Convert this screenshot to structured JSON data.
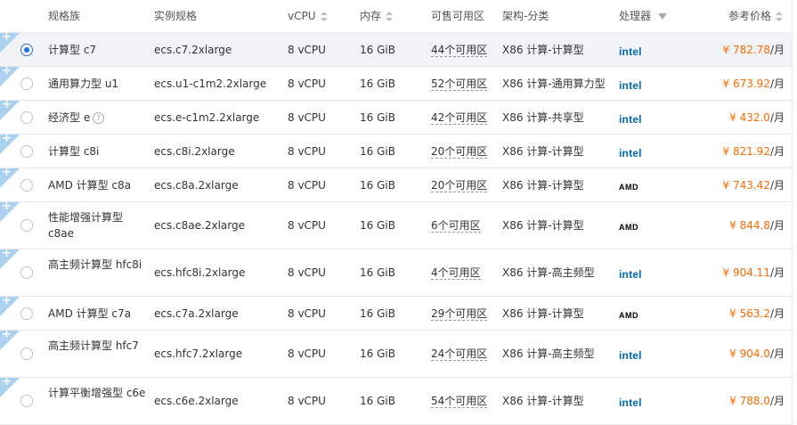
{
  "header": {
    "family": "规格族",
    "spec": "实例规格",
    "vcpu": "vCPU",
    "memory": "内存",
    "zones": "可售可用区",
    "arch": "架构-分类",
    "processor": "处理器",
    "price": "参考价格"
  },
  "rows": [
    {
      "family": "计算型 c7",
      "spec": "ecs.c7.2xlarge",
      "vcpu": "8 vCPU",
      "memory": "16 GiB",
      "zones": "44个可用区",
      "arch": "X86 计算-计算型",
      "processor": "intel",
      "price": "¥ 782.78",
      "unit": "/月",
      "selected": true
    },
    {
      "family": "通用算力型 u1",
      "spec": "ecs.u1-c1m2.2xlarge",
      "vcpu": "8 vCPU",
      "memory": "16 GiB",
      "zones": "52个可用区",
      "arch": "X86 计算-通用算力型",
      "processor": "intel",
      "price": "¥ 673.92",
      "unit": "/月"
    },
    {
      "family": "经济型 e",
      "spec": "ecs.e-c1m2.2xlarge",
      "vcpu": "8 vCPU",
      "memory": "16 GiB",
      "zones": "42个可用区",
      "arch": "X86 计算-共享型",
      "processor": "intel",
      "price": "¥ 432.0",
      "unit": "/月",
      "help": true
    },
    {
      "family": "计算型 c8i",
      "spec": "ecs.c8i.2xlarge",
      "vcpu": "8 vCPU",
      "memory": "16 GiB",
      "zones": "20个可用区",
      "arch": "X86 计算-计算型",
      "processor": "intel",
      "price": "¥ 821.92",
      "unit": "/月"
    },
    {
      "family": "AMD 计算型 c8a",
      "spec": "ecs.c8a.2xlarge",
      "vcpu": "8 vCPU",
      "memory": "16 GiB",
      "zones": "20个可用区",
      "arch": "X86 计算-计算型",
      "processor": "AMD",
      "price": "¥ 743.42",
      "unit": "/月"
    },
    {
      "family": "性能增强计算型 c8ae",
      "spec": "ecs.c8ae.2xlarge",
      "vcpu": "8 vCPU",
      "memory": "16 GiB",
      "zones": "6个可用区",
      "arch": "X86 计算-计算型",
      "processor": "AMD",
      "price": "¥ 844.8",
      "unit": "/月"
    },
    {
      "family": "高主频计算型 hfc8i",
      "spec": "ecs.hfc8i.2xlarge",
      "vcpu": "8 vCPU",
      "memory": "16 GiB",
      "zones": "4个可用区",
      "arch": "X86 计算-高主频型",
      "processor": "intel",
      "price": "¥ 904.11",
      "unit": "/月"
    },
    {
      "family": "AMD 计算型 c7a",
      "spec": "ecs.c7a.2xlarge",
      "vcpu": "8 vCPU",
      "memory": "16 GiB",
      "zones": "29个可用区",
      "arch": "X86 计算-计算型",
      "processor": "AMD",
      "price": "¥ 563.2",
      "unit": "/月"
    },
    {
      "family": "高主频计算型 hfc7",
      "spec": "ecs.hfc7.2xlarge",
      "vcpu": "8 vCPU",
      "memory": "16 GiB",
      "zones": "24个可用区",
      "arch": "X86 计算-高主频型",
      "processor": "intel",
      "price": "¥ 904.0",
      "unit": "/月"
    },
    {
      "family": "计算平衡增强型 c6e",
      "spec": "ecs.c6e.2xlarge",
      "vcpu": "8 vCPU",
      "memory": "16 GiB",
      "zones": "54个可用区",
      "arch": "X86 计算-计算型",
      "processor": "intel",
      "price": "¥ 788.0",
      "unit": "/月"
    }
  ],
  "colors": {
    "accent": "#1a73e8",
    "price": "#ff6a00",
    "intel": "#0068b5",
    "corner": "#aad1f0",
    "selected_bg": "#f2f3f7"
  },
  "icons": {
    "new_badge": "plus-corner-icon",
    "help": "question-circle-icon",
    "sort": "sort-icon",
    "filter": "filter-icon"
  }
}
